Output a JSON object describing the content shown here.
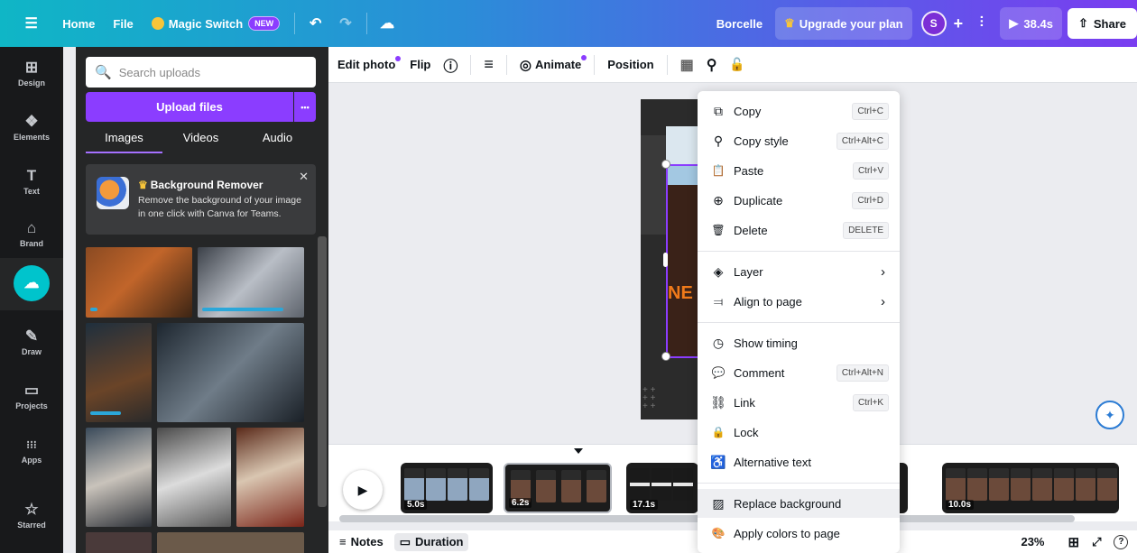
{
  "topbar": {
    "menu_icon": "☰",
    "home": "Home",
    "file": "File",
    "magic_switch": "Magic Switch",
    "new_badge": "NEW",
    "undo_icon": "↶",
    "redo_icon": "↷",
    "cloud_icon": "☁",
    "project_name": "Borcelle",
    "upgrade_crown": "♛",
    "upgrade": "Upgrade your plan",
    "avatar_initial": "S",
    "add_icon": "+",
    "analytics_icon": "⫶",
    "play_icon": "▶",
    "duration": "38.4s",
    "share_icon": "⇧",
    "share": "Share"
  },
  "rail": {
    "items": [
      {
        "label": "Design",
        "icon": "⊞"
      },
      {
        "label": "Elements",
        "icon": "❖"
      },
      {
        "label": "Text",
        "icon": "T"
      },
      {
        "label": "Brand",
        "icon": "⌂"
      },
      {
        "label": "",
        "icon": "☁"
      },
      {
        "label": "Draw",
        "icon": "✎"
      },
      {
        "label": "Projects",
        "icon": "▭"
      },
      {
        "label": "Apps",
        "icon": "⁝⁝⁝"
      },
      {
        "label": "Starred",
        "icon": "☆"
      }
    ]
  },
  "panel": {
    "search_icon": "🔍",
    "search_placeholder": "Search uploads",
    "upload_button": "Upload files",
    "more_icon": "•••",
    "tabs": [
      "Images",
      "Videos",
      "Audio"
    ],
    "promo_title": "Background Remover",
    "promo_crown": "♛",
    "promo_body": "Remove the background of your image in one click with Canva for Teams.",
    "close_icon": "✕",
    "collapse_icon": "‹"
  },
  "toolbar": {
    "edit_photo": "Edit photo",
    "flip": "Flip",
    "info_icon": "ⓘ",
    "lines_icon": "≡",
    "animate_icon": "◎",
    "animate": "Animate",
    "position": "Position",
    "transparency_icon": "▦",
    "copy_style_icon": "⚲",
    "lock_icon": "🔓"
  },
  "canvas": {
    "magic_fab_icon": "✦"
  },
  "timeline": {
    "play_icon": "▶",
    "clips": [
      {
        "duration": "5.0s"
      },
      {
        "duration": "6.2s"
      },
      {
        "duration": "17.1s"
      },
      {
        "duration": "10.0s"
      }
    ]
  },
  "bottombar": {
    "notes_icon": "≡",
    "notes": "Notes",
    "duration_icon": "▭",
    "duration": "Duration",
    "zoom": "23%",
    "grid_icon": "⊞",
    "fullscreen_icon": "⤢",
    "help_icon": "?"
  },
  "context_menu": {
    "copy": {
      "label": "Copy",
      "shortcut": "Ctrl+C",
      "icon": "⧉"
    },
    "copy_style": {
      "label": "Copy style",
      "shortcut": "Ctrl+Alt+C",
      "icon": "⚲"
    },
    "paste": {
      "label": "Paste",
      "shortcut": "Ctrl+V",
      "icon": "📋"
    },
    "duplicate": {
      "label": "Duplicate",
      "shortcut": "Ctrl+D",
      "icon": "⊕"
    },
    "delete": {
      "label": "Delete",
      "shortcut": "DELETE",
      "icon": "🗑"
    },
    "layer": {
      "label": "Layer",
      "icon": "◈",
      "chevron": "›"
    },
    "align": {
      "label": "Align to page",
      "icon": "⫤",
      "chevron": "›"
    },
    "show_timing": {
      "label": "Show timing",
      "icon": "◷"
    },
    "comment": {
      "label": "Comment",
      "shortcut": "Ctrl+Alt+N",
      "icon": "💬"
    },
    "link": {
      "label": "Link",
      "shortcut": "Ctrl+K",
      "icon": "⛓"
    },
    "lock": {
      "label": "Lock",
      "icon": "🔒"
    },
    "alt_text": {
      "label": "Alternative text",
      "icon": "♿"
    },
    "replace_bg": {
      "label": "Replace background",
      "icon": "▨"
    },
    "apply_colors": {
      "label": "Apply colors to page",
      "icon": "🎨"
    }
  }
}
